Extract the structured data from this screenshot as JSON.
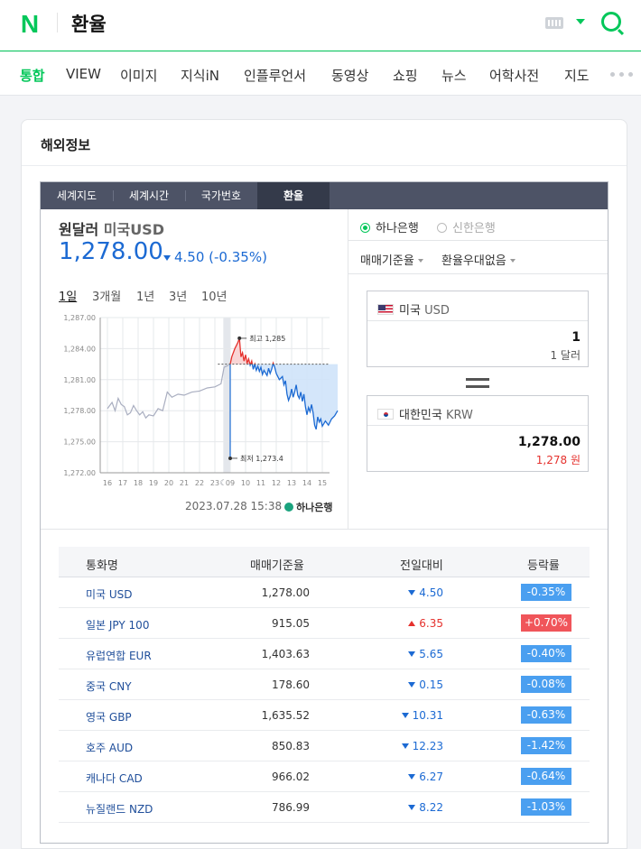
{
  "header": {
    "logo": "N",
    "query": "환율"
  },
  "tabs": [
    {
      "label": "통합",
      "active": true
    },
    {
      "label": "VIEW"
    },
    {
      "label": "이미지"
    },
    {
      "label": "지식iN"
    },
    {
      "label": "인플루언서"
    },
    {
      "label": "동영상"
    },
    {
      "label": "쇼핑"
    },
    {
      "label": "뉴스"
    },
    {
      "label": "어학사전"
    },
    {
      "label": "지도"
    }
  ],
  "card": {
    "title": "해외정보"
  },
  "subtabs": [
    "세계지도",
    "세계시간",
    "국가번호",
    "환율"
  ],
  "quote": {
    "pair": "원달러",
    "pair_code": "미국USD",
    "price": "1,278.00",
    "change": "4.50 (-0.35%)"
  },
  "periods": [
    "1일",
    "3개월",
    "1년",
    "3년",
    "10년"
  ],
  "chart_data": {
    "type": "line",
    "title": "",
    "y_ticks": [
      "1,287.00",
      "1,284.00",
      "1,281.00",
      "1,278.00",
      "1,275.00",
      "1,272.00"
    ],
    "x_ticks": [
      "16",
      "17",
      "18",
      "19",
      "20",
      "21",
      "22",
      "23",
      "09",
      "10",
      "11",
      "12",
      "13",
      "14",
      "15"
    ],
    "ylim": [
      1272,
      1287
    ],
    "previous_close": 1282.5,
    "high_label": "최고 1,285",
    "high": 1285,
    "low_label": "최저 1,273.4",
    "low": 1273.4,
    "prev_session": [
      [
        0,
        1278.2
      ],
      [
        0.3,
        1278.8
      ],
      [
        0.5,
        1278.0
      ],
      [
        0.7,
        1279.2
      ],
      [
        0.9,
        1278.6
      ],
      [
        1.1,
        1278.4
      ],
      [
        1.3,
        1277.6
      ],
      [
        1.5,
        1277.8
      ],
      [
        1.7,
        1278.5
      ],
      [
        1.9,
        1278.0
      ],
      [
        2.1,
        1277.6
      ],
      [
        2.3,
        1277.9
      ],
      [
        2.5,
        1277.3
      ],
      [
        2.7,
        1277.6
      ],
      [
        3.0,
        1277.5
      ],
      [
        3.3,
        1278.2
      ],
      [
        3.6,
        1278.0
      ],
      [
        3.9,
        1279.8
      ],
      [
        4.2,
        1279.3
      ],
      [
        4.6,
        1279.6
      ],
      [
        5.0,
        1279.5
      ],
      [
        5.5,
        1279.8
      ],
      [
        6.0,
        1279.9
      ],
      [
        6.5,
        1280.2
      ],
      [
        7.0,
        1280.3
      ],
      [
        7.4,
        1280.6
      ],
      [
        7.6,
        1282.2
      ],
      [
        7.9,
        1282.4
      ]
    ],
    "session": [
      [
        8.0,
        1282.5
      ],
      [
        8.1,
        1283.2
      ],
      [
        8.3,
        1284.0
      ],
      [
        8.5,
        1284.6
      ],
      [
        8.6,
        1285.0
      ],
      [
        8.7,
        1283.2
      ],
      [
        8.8,
        1283.6
      ],
      [
        8.9,
        1282.8
      ],
      [
        9.0,
        1283.4
      ],
      [
        9.1,
        1282.6
      ],
      [
        9.2,
        1283.0
      ],
      [
        9.3,
        1282.4
      ],
      [
        9.4,
        1282.8
      ],
      [
        9.5,
        1282.0
      ],
      [
        9.6,
        1282.5
      ],
      [
        9.7,
        1281.9
      ],
      [
        9.8,
        1282.3
      ],
      [
        9.9,
        1281.8
      ],
      [
        10.0,
        1282.2
      ],
      [
        10.1,
        1281.5
      ],
      [
        10.2,
        1281.9
      ],
      [
        10.4,
        1281.4
      ],
      [
        10.5,
        1282.1
      ],
      [
        10.6,
        1281.6
      ],
      [
        10.7,
        1282.0
      ],
      [
        10.8,
        1282.6
      ],
      [
        10.9,
        1282.2
      ],
      [
        11.0,
        1281.6
      ],
      [
        11.2,
        1281.0
      ],
      [
        11.4,
        1281.3
      ],
      [
        11.5,
        1280.5
      ],
      [
        11.6,
        1280.9
      ],
      [
        11.7,
        1279.6
      ],
      [
        11.8,
        1279.0
      ],
      [
        11.9,
        1279.4
      ],
      [
        12.0,
        1280.1
      ],
      [
        12.1,
        1279.3
      ],
      [
        12.2,
        1279.8
      ],
      [
        12.3,
        1280.5
      ],
      [
        12.4,
        1279.5
      ],
      [
        12.5,
        1279.2
      ],
      [
        12.6,
        1279.8
      ],
      [
        12.7,
        1278.9
      ],
      [
        12.8,
        1279.6
      ],
      [
        12.9,
        1278.4
      ],
      [
        13.0,
        1277.6
      ],
      [
        13.1,
        1278.3
      ],
      [
        13.2,
        1277.9
      ],
      [
        13.3,
        1278.6
      ],
      [
        13.4,
        1277.8
      ],
      [
        13.5,
        1276.6
      ],
      [
        13.6,
        1276.2
      ],
      [
        13.7,
        1277.4
      ],
      [
        13.8,
        1276.9
      ],
      [
        13.9,
        1277.2
      ],
      [
        14.0,
        1276.5
      ],
      [
        14.2,
        1277.0
      ],
      [
        14.4,
        1276.6
      ],
      [
        14.6,
        1277.2
      ],
      [
        14.8,
        1277.5
      ],
      [
        15.0,
        1278.0
      ]
    ]
  },
  "timestamp": "2023.07.28 15:38",
  "bank_logo": "하나은행",
  "banks": [
    {
      "label": "하나은행",
      "on": true
    },
    {
      "label": "신한은행",
      "on": false
    }
  ],
  "selectors": [
    "매매기준율",
    "환율우대없음"
  ],
  "converter": [
    {
      "country": "미국",
      "code": "USD",
      "value": "1",
      "unit": "1 달러"
    },
    {
      "country": "대한민국",
      "code": "KRW",
      "value": "1,278.00",
      "unit": "1,278 원"
    }
  ],
  "table": {
    "headers": [
      "통화명",
      "매매기준율",
      "전일대비",
      "등락률"
    ],
    "rows": [
      {
        "name": "미국 USD",
        "rate": "1,278.00",
        "diff": "4.50",
        "dir": "down",
        "pct": "-0.35%"
      },
      {
        "name": "일본 JPY 100",
        "rate": "915.05",
        "diff": "6.35",
        "dir": "up",
        "pct": "+0.70%"
      },
      {
        "name": "유럽연합 EUR",
        "rate": "1,403.63",
        "diff": "5.65",
        "dir": "down",
        "pct": "-0.40%"
      },
      {
        "name": "중국 CNY",
        "rate": "178.60",
        "diff": "0.15",
        "dir": "down",
        "pct": "-0.08%"
      },
      {
        "name": "영국 GBP",
        "rate": "1,635.52",
        "diff": "10.31",
        "dir": "down",
        "pct": "-0.63%"
      },
      {
        "name": "호주 AUD",
        "rate": "850.83",
        "diff": "12.23",
        "dir": "down",
        "pct": "-1.42%"
      },
      {
        "name": "캐나다 CAD",
        "rate": "966.02",
        "diff": "6.27",
        "dir": "down",
        "pct": "-0.64%"
      },
      {
        "name": "뉴질랜드 NZD",
        "rate": "786.99",
        "diff": "8.22",
        "dir": "down",
        "pct": "-1.03%"
      }
    ]
  }
}
